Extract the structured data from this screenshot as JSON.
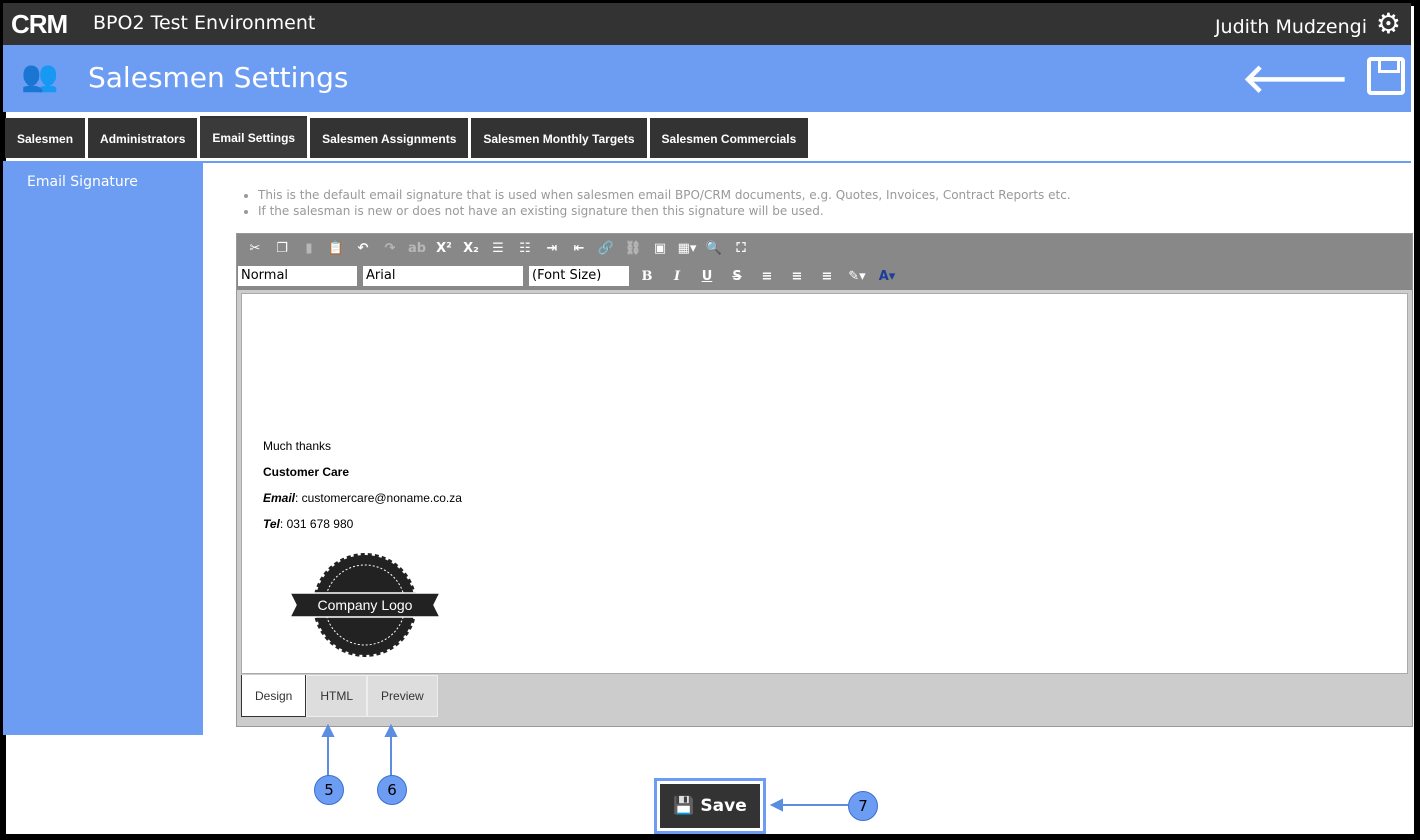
{
  "header": {
    "logo": "CRM",
    "environment": "BPO2 Test Environment",
    "user": "Judith Mudzengi"
  },
  "page": {
    "title": "Salesmen Settings"
  },
  "tabs": [
    "Salesmen",
    "Administrators",
    "Email Settings",
    "Salesmen Assignments",
    "Salesmen Monthly Targets",
    "Salesmen Commercials"
  ],
  "active_tab": "Email Settings",
  "sidebar": {
    "items": [
      {
        "label": "Email Signature"
      }
    ]
  },
  "notes": [
    "This is the default email signature that is used when salesmen email BPO/CRM documents, e.g. Quotes, Invoices, Contract Reports etc.",
    "If the salesman is new or does not have an existing signature then this signature will be used."
  ],
  "toolbar": {
    "format": "Normal",
    "font": "Arial",
    "font_size": "(Font Size)",
    "row1": [
      "cut",
      "copy",
      "paste",
      "paste-word",
      "undo",
      "redo",
      "spellcheck",
      "superscript",
      "subscript",
      "ordered-list",
      "unordered-list",
      "indent",
      "outdent",
      "link",
      "unlink",
      "image",
      "table",
      "find",
      "fullscreen"
    ]
  },
  "signature": {
    "line1": "Much thanks",
    "line2": "Customer Care",
    "email_label": "Email",
    "email": ": customercare@noname.co.za",
    "tel_label": "Tel",
    "tel": ": 031 678 980",
    "logo_text": "Company Logo"
  },
  "editor_tabs": [
    "Design",
    "HTML",
    "Preview"
  ],
  "annotations": [
    "5",
    "6",
    "7"
  ],
  "save_label": "Save",
  "colors": {
    "accent": "#6d9cf3",
    "dark": "#333333"
  }
}
